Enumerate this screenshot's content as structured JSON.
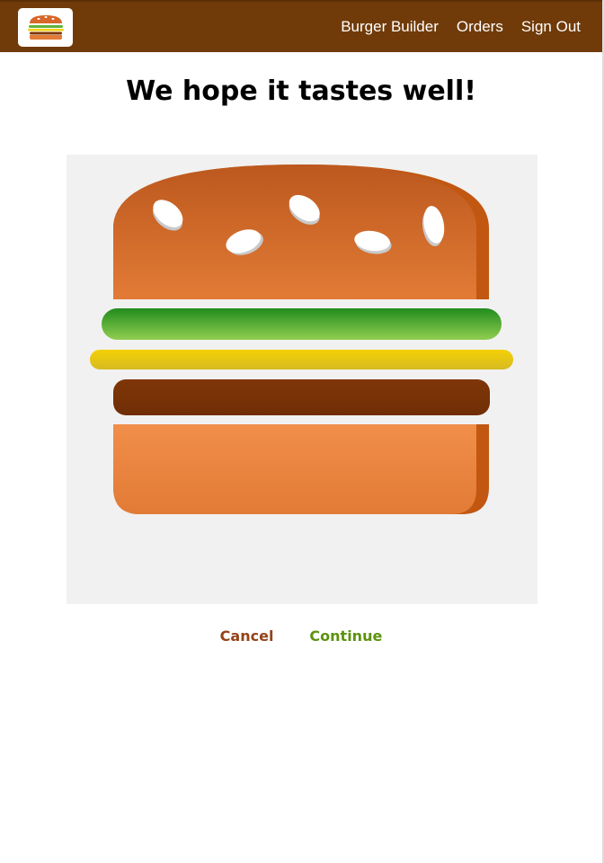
{
  "app": {
    "logo_icon": "burger-logo-icon"
  },
  "nav": {
    "items": [
      {
        "label": "Burger Builder"
      },
      {
        "label": "Orders"
      },
      {
        "label": "Sign Out"
      }
    ]
  },
  "main": {
    "title": "We hope it tastes well!"
  },
  "burger": {
    "ingredients": [
      "bread-top",
      "salad",
      "cheese",
      "meat",
      "bread-bottom"
    ],
    "seed_count": 5
  },
  "actions": {
    "cancel_label": "Cancel",
    "continue_label": "Continue"
  },
  "colors": {
    "toolbar": "#703b09",
    "cancel": "#944317",
    "continue": "#5c9210",
    "bread": "#e27b36",
    "salad": "#228c1d",
    "cheese": "#f4d004",
    "meat": "#7f3608"
  }
}
